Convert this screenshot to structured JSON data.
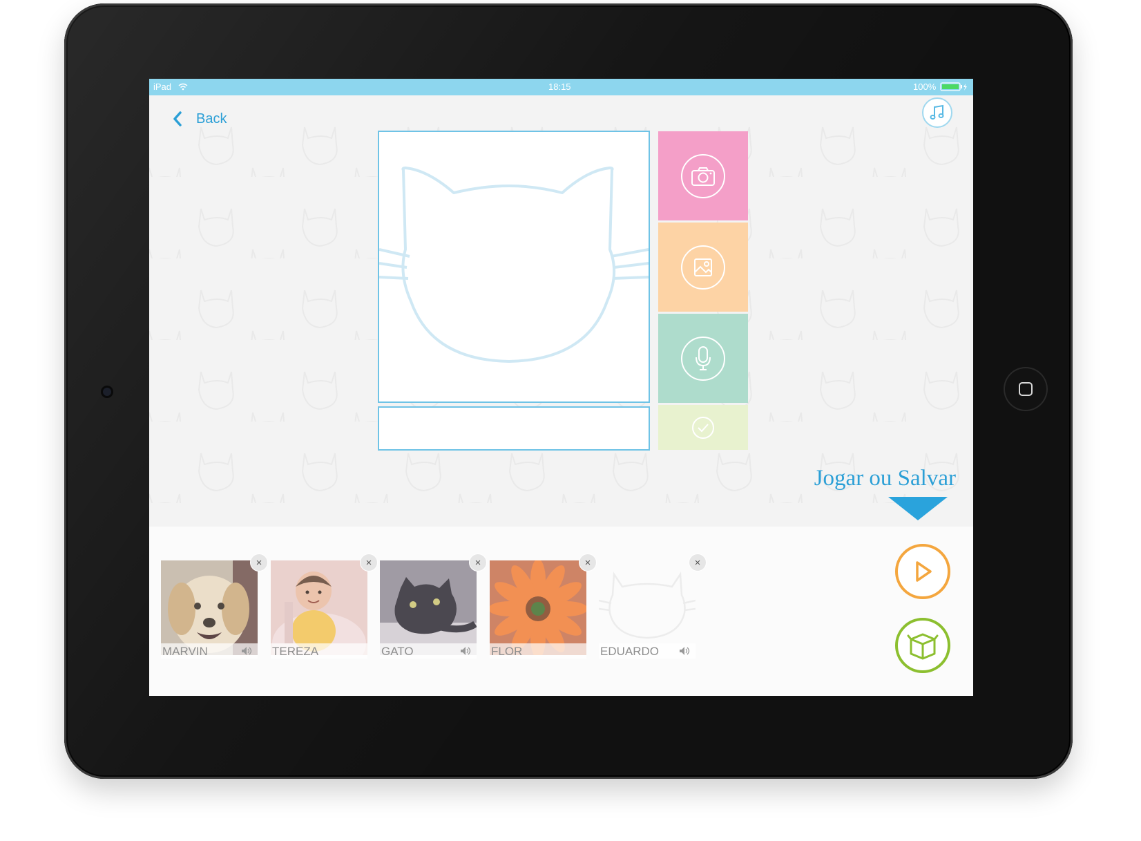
{
  "status_bar": {
    "device": "iPad",
    "time": "18:15",
    "battery": "100%"
  },
  "nav": {
    "back_label": "Back"
  },
  "icons": {
    "back": "chevron-left-icon",
    "music": "music-note-icon",
    "camera": "camera-icon",
    "gallery": "image-icon",
    "record": "microphone-icon",
    "confirm": "checkmark-icon",
    "play": "play-icon",
    "save": "box-icon",
    "remove": "close-icon",
    "sound": "speaker-icon"
  },
  "editor": {
    "name_value": ""
  },
  "hint": {
    "text": "Jogar ou Salvar"
  },
  "cards": [
    {
      "name": "MARVIN",
      "remove_label": "×"
    },
    {
      "name": "TEREZA",
      "remove_label": "×"
    },
    {
      "name": "GATO",
      "remove_label": "×"
    },
    {
      "name": "FLOR",
      "remove_label": "×"
    },
    {
      "name": "EDUARDO",
      "remove_label": "×"
    }
  ],
  "colors": {
    "status_bar": "#8dd6ee",
    "accent_blue": "#2b9fd6",
    "camera_tile": "#f49fc8",
    "gallery_tile": "#fdd3a5",
    "mic_tile": "#aedccc",
    "check_tile": "#e8f2cf",
    "play_orange": "#f4a63e",
    "save_green": "#8cbf2f"
  }
}
